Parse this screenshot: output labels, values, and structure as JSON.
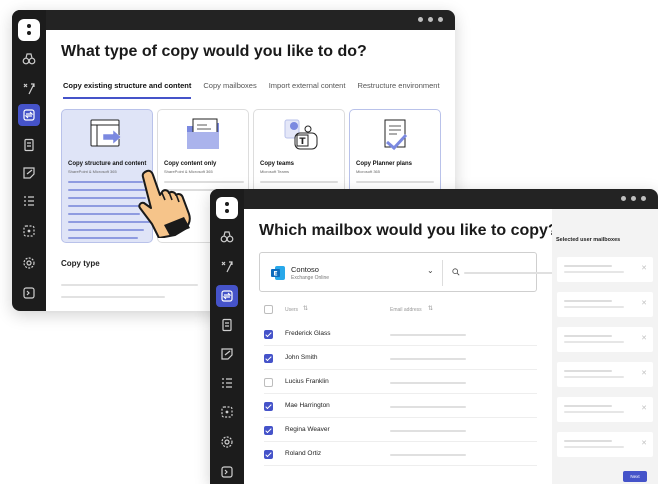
{
  "back_window": {
    "title": "What type of copy would you like to do?",
    "tabs": [
      {
        "label": "Copy existing structure and content",
        "active": true
      },
      {
        "label": "Copy mailboxes",
        "active": false
      },
      {
        "label": "Import external content",
        "active": false
      },
      {
        "label": "Restructure environment",
        "active": false
      }
    ],
    "cards": [
      {
        "title": "Copy structure and content",
        "subtitle": "SharePoint & Microsoft 365",
        "selected": true
      },
      {
        "title": "Copy content only",
        "subtitle": "SharePoint & Microsoft 365",
        "selected": false
      },
      {
        "title": "Copy teams",
        "subtitle": "Microsoft Teams",
        "selected": false
      },
      {
        "title": "Copy Planner plans",
        "subtitle": "Microsoft 365",
        "selected": false
      }
    ],
    "section_label": "Copy type"
  },
  "front_window": {
    "title": "Which mailbox would you like to copy?",
    "account": {
      "name": "Contoso",
      "service": "Exchange Online",
      "icon": "exchange-icon"
    },
    "columns": {
      "users": "Users",
      "email": "Email address"
    },
    "rows": [
      {
        "name": "Frederick Glass",
        "checked": true
      },
      {
        "name": "John Smith",
        "checked": true
      },
      {
        "name": "Lucius Franklin",
        "checked": false
      },
      {
        "name": "Mae Harrington",
        "checked": true
      },
      {
        "name": "Regina Weaver",
        "checked": true
      },
      {
        "name": "Roland Ortiz",
        "checked": true
      }
    ],
    "selected_panel_title": "Selected user mailboxes",
    "next_label": "Next"
  },
  "colors": {
    "accent": "#4553c9",
    "sidebar": "#1c1c1c",
    "selected_card": "#dfe4f7"
  }
}
